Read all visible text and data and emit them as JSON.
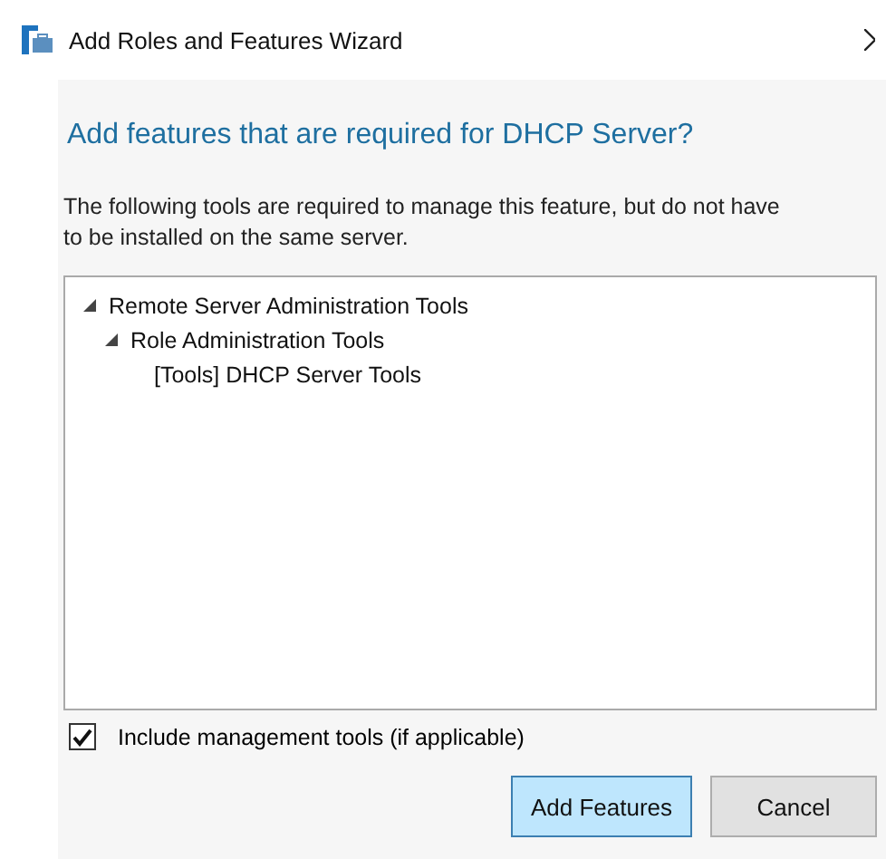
{
  "window": {
    "title": "Add Roles and Features Wizard"
  },
  "heading": "Add features that are required for DHCP Server?",
  "description": "The following tools are required to manage this feature, but do not have to be installed on the same server.",
  "tree": [
    {
      "label": "Remote Server Administration Tools",
      "expanded": true,
      "children": [
        {
          "label": "Role Administration Tools",
          "expanded": true,
          "children": [
            {
              "label": "[Tools] DHCP Server Tools"
            }
          ]
        }
      ]
    }
  ],
  "include_tools": {
    "label": "Include management tools (if applicable)",
    "checked": true
  },
  "buttons": [
    {
      "label": "Add Features",
      "default": true
    },
    {
      "label": "Cancel",
      "default": false
    }
  ]
}
